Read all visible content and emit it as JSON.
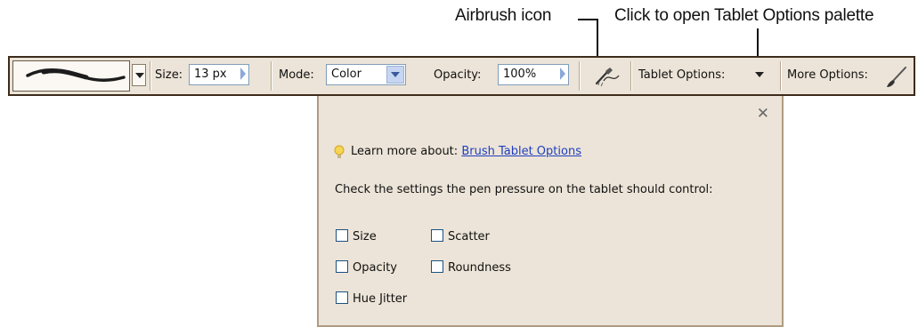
{
  "callouts": {
    "airbrush": "Airbrush icon",
    "tablet": "Click to open Tablet Options palette"
  },
  "toolbar": {
    "size_label": "Size:",
    "size_value": "13 px",
    "mode_label": "Mode:",
    "mode_value": "Color",
    "opacity_label": "Opacity:",
    "opacity_value": "100%",
    "tablet_label": "Tablet Options:",
    "more_label": "More Options:"
  },
  "palette": {
    "learn_prefix": "Learn more about:",
    "learn_link": "Brush Tablet Options",
    "instruction": "Check the settings the pen pressure on the tablet should control:",
    "checkboxes": [
      {
        "label": "Size",
        "checked": false
      },
      {
        "label": "Scatter",
        "checked": false
      },
      {
        "label": "Opacity",
        "checked": false
      },
      {
        "label": "Roundness",
        "checked": false
      },
      {
        "label": "Hue Jitter",
        "checked": false
      }
    ]
  },
  "colors": {
    "bar_bg": "#ece4d8",
    "field_border": "#7f9db9",
    "link": "#1f3fbf",
    "checkbox_border": "#1c5180"
  }
}
